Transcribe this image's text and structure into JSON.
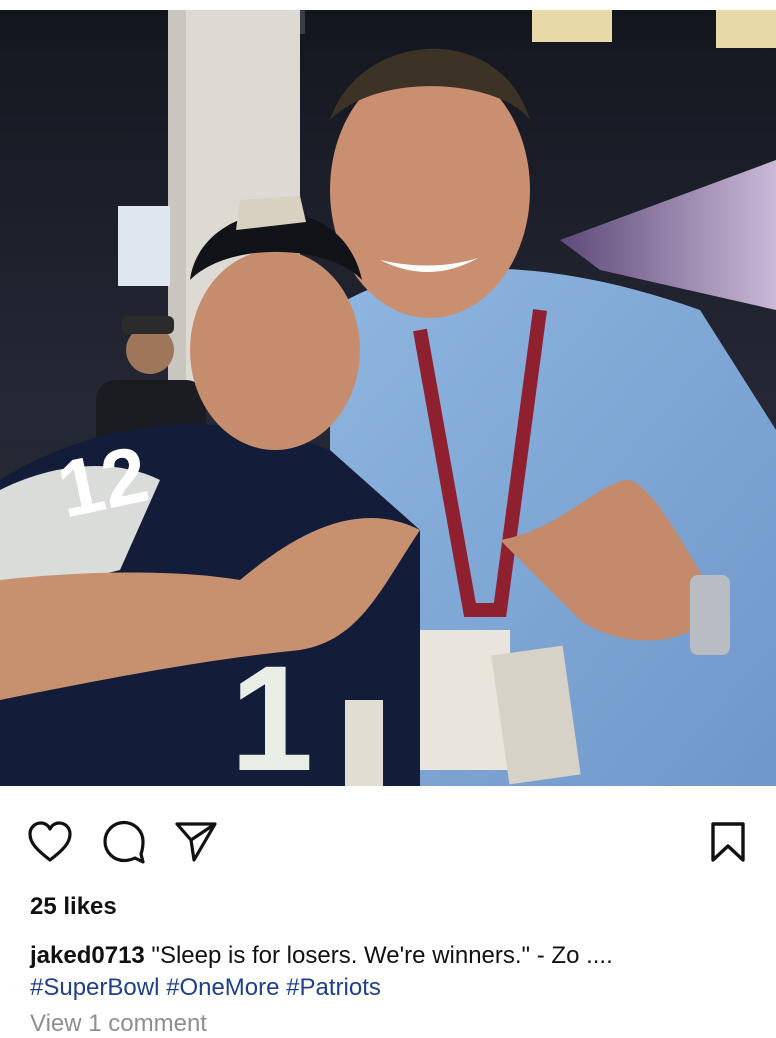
{
  "post": {
    "photo_icon": "post-photo",
    "actions": {
      "like_icon": "heart-outline-icon",
      "comment_icon": "comment-bubble-icon",
      "share_icon": "paper-plane-icon",
      "save_icon": "bookmark-outline-icon"
    },
    "likes_text": "25 likes",
    "caption": {
      "username": "jaked0713",
      "text": " \"Sleep is for losers. We're winners.\" - Zo ....",
      "hashtags": [
        "#SuperBowl",
        "#OneMore",
        "#Patriots"
      ]
    },
    "view_comments_text": "View 1 comment"
  },
  "colors": {
    "hashtag": "#1f3f8f",
    "muted": "#8e8e8e",
    "text": "#111111"
  }
}
